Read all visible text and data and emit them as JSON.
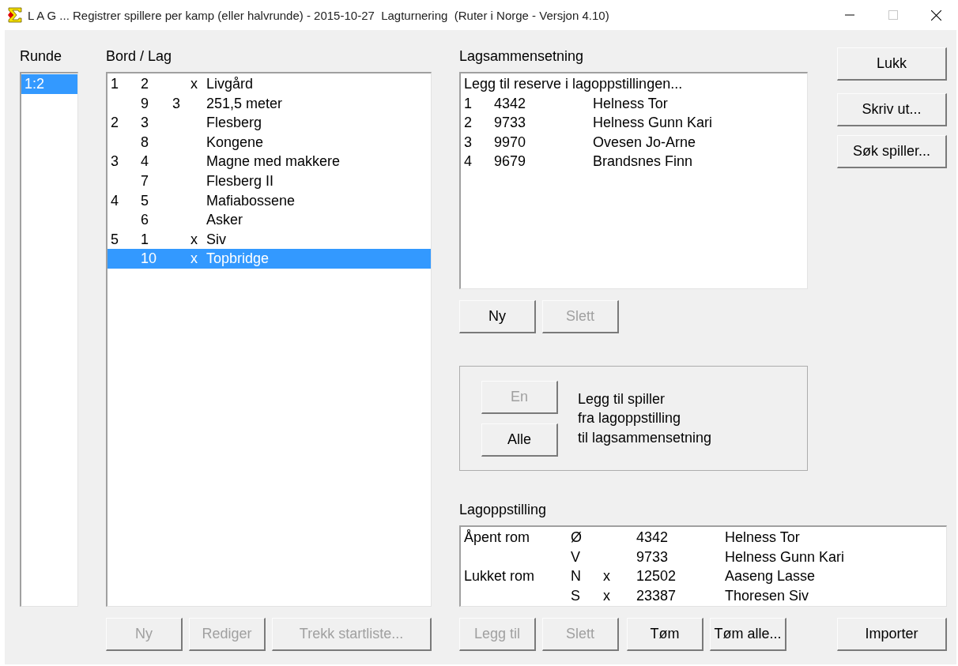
{
  "window": {
    "title": "L A G ... Registrer spillere per kamp (eller halvrunde) - 2015-10-27  Lagturnering  (Ruter i Norge - Versjon 4.10)",
    "maximize_disabled": true
  },
  "rounds": {
    "label": "Runde",
    "items": [
      {
        "label": "1:2",
        "selected": true
      }
    ]
  },
  "matches": {
    "label": "Bord / Lag",
    "rows": [
      {
        "table": "1",
        "team_no": "2",
        "flag": "x",
        "name": "Livgård",
        "selected": false
      },
      {
        "team_no": "9",
        "column_3": "3",
        "name": "251,5 meter",
        "selected": false
      },
      {
        "table": "2",
        "team_no": "3",
        "name": "Flesberg",
        "selected": false
      },
      {
        "team_no": "8",
        "name": "Kongene",
        "selected": false
      },
      {
        "table": "3",
        "team_no": "4",
        "name": "Magne med makkere",
        "selected": false
      },
      {
        "team_no": "7",
        "name": "Flesberg II",
        "selected": false
      },
      {
        "table": "4",
        "team_no": "5",
        "name": "Mafiabossene",
        "selected": false
      },
      {
        "team_no": "6",
        "name": "Asker",
        "selected": false
      },
      {
        "table": "5",
        "team_no": "1",
        "flag": "x",
        "name": "Siv",
        "selected": false
      },
      {
        "team_no": "10",
        "flag": "x",
        "name": "Topbridge",
        "selected": true
      }
    ],
    "buttons": [
      {
        "label": "Ny",
        "disabled": true
      },
      {
        "label": "Rediger",
        "disabled": true
      },
      {
        "label": "Trekk startliste...",
        "disabled": true
      }
    ]
  },
  "composition": {
    "label": "Lagsammensetning",
    "rows": [
      {
        "kind": "action",
        "text": "Legg til reserve i lagoppstillingen...",
        "selected": false
      },
      {
        "kind": "player",
        "number": "1",
        "id": "4342",
        "name": "Helness Tor",
        "selected": false
      },
      {
        "kind": "player",
        "number": "2",
        "id": "9733",
        "name": "Helness Gunn Kari",
        "selected": false
      },
      {
        "kind": "player",
        "number": "3",
        "id": "9970",
        "name": "Ovesen Jo-Arne",
        "selected": false
      },
      {
        "kind": "player",
        "number": "4",
        "id": "9679",
        "name": "Brandsnes Finn",
        "selected": false
      }
    ],
    "buttons": [
      {
        "label": "Ny",
        "disabled": false
      },
      {
        "label": "Slett",
        "disabled": true
      }
    ]
  },
  "transfer": {
    "buttons": [
      {
        "label": "En",
        "disabled": true
      },
      {
        "label": "Alle",
        "disabled": false
      }
    ],
    "text": [
      "Legg til spiller",
      "fra lagoppstilling",
      "til lagsammensetning"
    ]
  },
  "side_buttons": [
    {
      "label": "Lukk",
      "disabled": false
    },
    {
      "label": "Skriv ut...",
      "disabled": false
    },
    {
      "label": "Søk spiller...",
      "disabled": false
    }
  ],
  "lineup": {
    "label": "Lagoppstilling",
    "rows": [
      {
        "room": "Åpent rom",
        "seat": "Ø",
        "id": "4342",
        "name": "Helness Tor"
      },
      {
        "seat": "V",
        "id": "9733",
        "name": "Helness Gunn Kari"
      },
      {
        "room": "Lukket rom",
        "seat": "N",
        "flag": "x",
        "id": "12502",
        "name": "Aaseng Lasse"
      },
      {
        "seat": "S",
        "flag": "x",
        "id": "23387",
        "name": "Thoresen Siv"
      }
    ],
    "buttons": [
      {
        "label": "Legg til",
        "disabled": true
      },
      {
        "label": "Slett",
        "disabled": true
      },
      {
        "label": "Tøm",
        "disabled": false
      },
      {
        "label": "Tøm alle...",
        "disabled": false
      }
    ]
  },
  "import_button": {
    "label": "Importer",
    "disabled": false
  }
}
